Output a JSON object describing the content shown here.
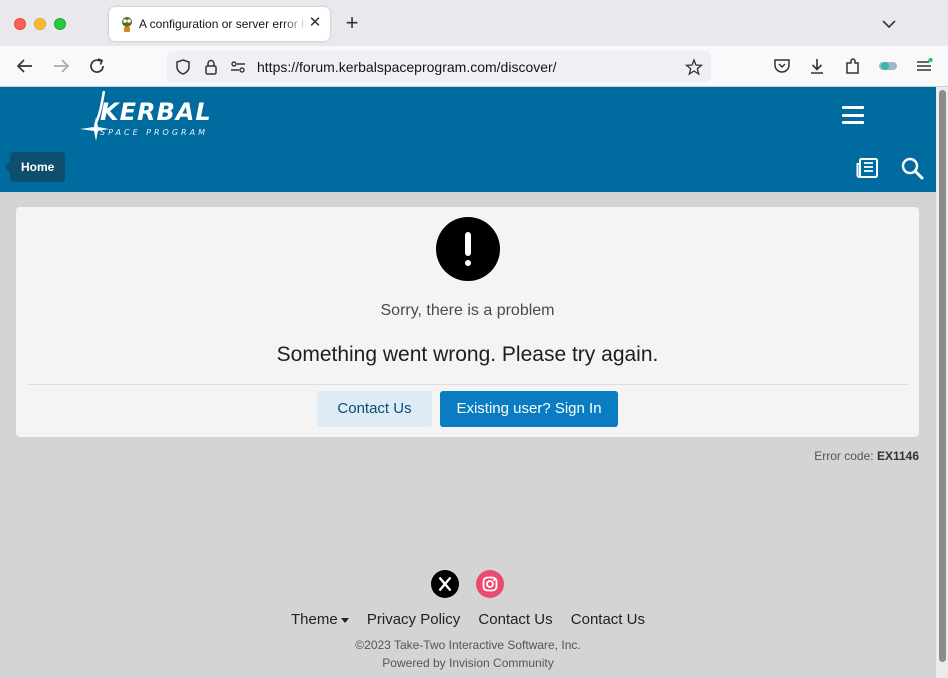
{
  "browser": {
    "tab_title": "A configuration or server error has occurred",
    "url": "https://forum.kerbalspaceprogram.com/discover/"
  },
  "site": {
    "logo_text": "KERBAL",
    "logo_subtext": "SPACE PROGRAM",
    "breadcrumb_home": "Home",
    "brand_color": "#006b9f"
  },
  "error": {
    "heading": "Sorry, there is a problem",
    "message": "Something went wrong. Please try again.",
    "contact_button": "Contact Us",
    "signin_button": "Existing user? Sign In",
    "code_label": "Error code:",
    "code": "EX1146"
  },
  "footer": {
    "links": [
      "Theme",
      "Privacy Policy",
      "Contact Us",
      "Contact Us"
    ],
    "copyright": "©2023 Take-Two Interactive Software, Inc.",
    "powered_by": "Powered by Invision Community",
    "social": [
      "x-icon",
      "instagram-icon"
    ]
  }
}
